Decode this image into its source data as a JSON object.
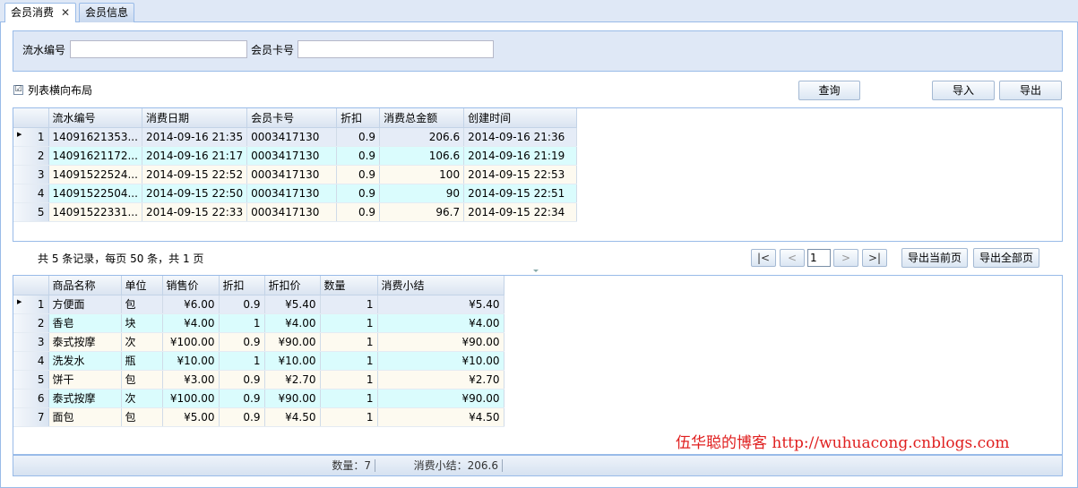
{
  "tabs": [
    {
      "label": "会员消费",
      "close": "✕"
    },
    {
      "label": "会员信息"
    }
  ],
  "search": {
    "serial_label": "流水编号",
    "serial_value": "",
    "card_label": "会员卡号",
    "card_value": ""
  },
  "layout_option": {
    "label": "列表横向布局",
    "checked": "☑"
  },
  "toolbar": {
    "query": "查询",
    "import": "导入",
    "export": "导出"
  },
  "orders": {
    "columns": [
      "流水编号",
      "消费日期",
      "会员卡号",
      "折扣",
      "消费总金额",
      "创建时间"
    ],
    "rows": [
      [
        "1",
        "14091621353...",
        "2014-09-16 21:35",
        "0003417130",
        "0.9",
        "206.6",
        "2014-09-16 21:36"
      ],
      [
        "2",
        "14091621172...",
        "2014-09-16 21:17",
        "0003417130",
        "0.9",
        "106.6",
        "2014-09-16 21:19"
      ],
      [
        "3",
        "14091522524...",
        "2014-09-15 22:52",
        "0003417130",
        "0.9",
        "100",
        "2014-09-15 22:53"
      ],
      [
        "4",
        "14091522504...",
        "2014-09-15 22:50",
        "0003417130",
        "0.9",
        "90",
        "2014-09-15 22:51"
      ],
      [
        "5",
        "14091522331...",
        "2014-09-15 22:33",
        "0003417130",
        "0.9",
        "96.7",
        "2014-09-15 22:34"
      ]
    ]
  },
  "pager": {
    "summary": "共 5 条记录，每页 50 条，共 1 页",
    "first": "|<",
    "prev": "<",
    "page": "1",
    "next": ">",
    "last": ">|",
    "export_page": "导出当前页",
    "export_all": "导出全部页"
  },
  "details": {
    "columns": [
      "商品名称",
      "单位",
      "销售价",
      "折扣",
      "折扣价",
      "数量",
      "消费小结"
    ],
    "rows": [
      [
        "1",
        "方便面",
        "包",
        "¥6.00",
        "0.9",
        "¥5.40",
        "1",
        "¥5.40"
      ],
      [
        "2",
        "香皂",
        "块",
        "¥4.00",
        "1",
        "¥4.00",
        "1",
        "¥4.00"
      ],
      [
        "3",
        "泰式按摩",
        "次",
        "¥100.00",
        "0.9",
        "¥90.00",
        "1",
        "¥90.00"
      ],
      [
        "4",
        "洗发水",
        "瓶",
        "¥10.00",
        "1",
        "¥10.00",
        "1",
        "¥10.00"
      ],
      [
        "5",
        "饼干",
        "包",
        "¥3.00",
        "0.9",
        "¥2.70",
        "1",
        "¥2.70"
      ],
      [
        "6",
        "泰式按摩",
        "次",
        "¥100.00",
        "0.9",
        "¥90.00",
        "1",
        "¥90.00"
      ],
      [
        "7",
        "面包",
        "包",
        "¥5.00",
        "0.9",
        "¥4.50",
        "1",
        "¥4.50"
      ]
    ]
  },
  "footer": {
    "quantity": "数量：7",
    "subtotal": "消费小结：206.6"
  },
  "watermark": "伍华聪的博客 http://wuhuacong.cnblogs.com",
  "row_marker": "▶"
}
